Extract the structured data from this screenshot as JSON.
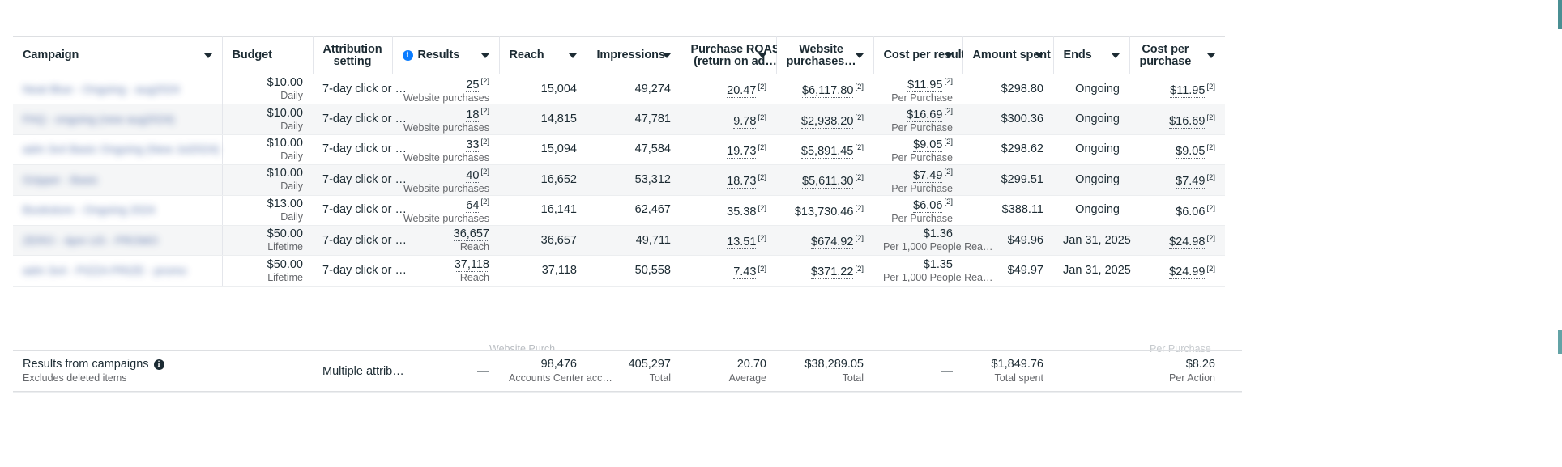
{
  "table": {
    "columns": [
      {
        "id": "campaign",
        "label": "Campaign",
        "sortable": true,
        "info": false,
        "align": "left"
      },
      {
        "id": "budget",
        "label": "Budget",
        "sortable": false,
        "info": false,
        "align": "right"
      },
      {
        "id": "attribution_setting",
        "label": "Attribution",
        "label2": "setting",
        "sortable": false,
        "info": false,
        "align": "left"
      },
      {
        "id": "results",
        "label": "Results",
        "sortable": true,
        "info": true,
        "align": "right"
      },
      {
        "id": "reach",
        "label": "Reach",
        "sortable": true,
        "info": false,
        "align": "right"
      },
      {
        "id": "impressions",
        "label": "Impressions",
        "sortable": true,
        "info": false,
        "align": "right"
      },
      {
        "id": "purchase_roas",
        "label": "Purchase ROAS",
        "label2": "(return on ad…",
        "sortable": true,
        "info": false,
        "align": "right"
      },
      {
        "id": "website_purchases",
        "label": "Website",
        "label2": "purchases…",
        "sortable": true,
        "info": false,
        "align": "right"
      },
      {
        "id": "cost_per_result",
        "label": "Cost per result",
        "sortable": true,
        "info": false,
        "align": "right"
      },
      {
        "id": "amount_spent",
        "label": "Amount spent",
        "sortable": true,
        "info": false,
        "align": "right"
      },
      {
        "id": "ends",
        "label": "Ends",
        "sortable": true,
        "info": false,
        "align": "right"
      },
      {
        "id": "cost_per_purchase",
        "label": "Cost per",
        "label2": "purchase",
        "sortable": true,
        "info": false,
        "align": "right"
      }
    ],
    "rows": [
      {
        "campaign": "Neat Blue - Ongoing - aug2024",
        "budget": "$10.00",
        "budget_sub": "Daily",
        "attribution": "7-day click or …",
        "results": "25",
        "results_sup": "[2]",
        "results_sub": "Website purchases",
        "reach": "15,004",
        "impressions": "49,274",
        "roas": "20.47",
        "roas_sup": "[2]",
        "website_purchases": "$6,117.80",
        "website_purchases_sup": "[2]",
        "cost_per_result": "$11.95",
        "cost_per_result_sup": "[2]",
        "cost_per_result_sub": "Per Purchase",
        "amount_spent": "$298.80",
        "ends": "Ongoing",
        "cost_per_purchase": "$11.95",
        "cost_per_purchase_sup": "[2]"
      },
      {
        "campaign": "FAQ - ongoing (new aug2024)",
        "budget": "$10.00",
        "budget_sub": "Daily",
        "attribution": "7-day click or …",
        "results": "18",
        "results_sup": "[2]",
        "results_sub": "Website purchases",
        "reach": "14,815",
        "impressions": "47,781",
        "roas": "9.78",
        "roas_sup": "[2]",
        "website_purchases": "$2,938.20",
        "website_purchases_sup": "[2]",
        "cost_per_result": "$16.69",
        "cost_per_result_sup": "[2]",
        "cost_per_result_sub": "Per Purchase",
        "amount_spent": "$300.36",
        "ends": "Ongoing",
        "cost_per_purchase": "$16.69",
        "cost_per_purchase_sup": "[2]"
      },
      {
        "campaign": "adm 3x4 Basic Ongoing (New Jul2024)",
        "budget": "$10.00",
        "budget_sub": "Daily",
        "attribution": "7-day click or …",
        "results": "33",
        "results_sup": "[2]",
        "results_sub": "Website purchases",
        "reach": "15,094",
        "impressions": "47,584",
        "roas": "19.73",
        "roas_sup": "[2]",
        "website_purchases": "$5,891.45",
        "website_purchases_sup": "[2]",
        "cost_per_result": "$9.05",
        "cost_per_result_sup": "[2]",
        "cost_per_result_sub": "Per Purchase",
        "amount_spent": "$298.62",
        "ends": "Ongoing",
        "cost_per_purchase": "$9.05",
        "cost_per_purchase_sup": "[2]"
      },
      {
        "campaign": "Gripper - Basic",
        "budget": "$10.00",
        "budget_sub": "Daily",
        "attribution": "7-day click or …",
        "results": "40",
        "results_sup": "[2]",
        "results_sub": "Website purchases",
        "reach": "16,652",
        "impressions": "53,312",
        "roas": "18.73",
        "roas_sup": "[2]",
        "website_purchases": "$5,611.30",
        "website_purchases_sup": "[2]",
        "cost_per_result": "$7.49",
        "cost_per_result_sup": "[2]",
        "cost_per_result_sub": "Per Purchase",
        "amount_spent": "$299.51",
        "ends": "Ongoing",
        "cost_per_purchase": "$7.49",
        "cost_per_purchase_sup": "[2]"
      },
      {
        "campaign": "Bookstore - Ongoing 2024",
        "budget": "$13.00",
        "budget_sub": "Daily",
        "attribution": "7-day click or …",
        "results": "64",
        "results_sup": "[2]",
        "results_sub": "Website purchases",
        "reach": "16,141",
        "impressions": "62,467",
        "roas": "35.38",
        "roas_sup": "[2]",
        "website_purchases": "$13,730.46",
        "website_purchases_sup": "[2]",
        "cost_per_result": "$6.06",
        "cost_per_result_sup": "[2]",
        "cost_per_result_sub": "Per Purchase",
        "amount_spent": "$388.11",
        "ends": "Ongoing",
        "cost_per_purchase": "$6.06",
        "cost_per_purchase_sup": "[2]"
      },
      {
        "campaign": "ZERO - 4pm US - PROMO",
        "budget": "$50.00",
        "budget_sub": "Lifetime",
        "attribution": "7-day click or …",
        "results": "36,657",
        "results_sup": "",
        "results_sub": "Reach",
        "reach": "36,657",
        "impressions": "49,711",
        "roas": "13.51",
        "roas_sup": "[2]",
        "website_purchases": "$674.92",
        "website_purchases_sup": "[2]",
        "cost_per_result": "$1.36",
        "cost_per_result_sup": "",
        "cost_per_result_sub": "Per 1,000 People Rea…",
        "amount_spent": "$49.96",
        "ends": "Jan 31, 2025",
        "cost_per_purchase": "$24.98",
        "cost_per_purchase_sup": "[2]"
      },
      {
        "campaign": "adm 3x4 - PIZZA PRIZE - promo",
        "budget": "$50.00",
        "budget_sub": "Lifetime",
        "attribution": "7-day click or …",
        "results": "37,118",
        "results_sup": "",
        "results_sub": "Reach",
        "reach": "37,118",
        "impressions": "50,558",
        "roas": "7.43",
        "roas_sup": "[2]",
        "website_purchases": "$371.22",
        "website_purchases_sup": "[2]",
        "cost_per_result": "$1.35",
        "cost_per_result_sup": "",
        "cost_per_result_sub": "Per 1,000 People Rea…",
        "amount_spent": "$49.97",
        "ends": "Jan 31, 2025",
        "cost_per_purchase": "$24.99",
        "cost_per_purchase_sup": "[2]"
      }
    ],
    "partial_row_text": "Website Purch…",
    "partial_row_text_right": "Per Purchase"
  },
  "summary": {
    "title": "Results from campaigns",
    "subtitle": "Excludes deleted items",
    "attribution": "Multiple attrib…",
    "results": "—",
    "reach": "98,476",
    "reach_sub": "Accounts Center acc…",
    "impressions": "405,297",
    "impressions_sub": "Total",
    "roas": "20.70",
    "roas_sub": "Average",
    "website_purchases": "$38,289.05",
    "website_purchases_sub": "Total",
    "cost_per_result": "—",
    "amount_spent": "$1,849.76",
    "amount_spent_sub": "Total spent",
    "ends": "",
    "cost_per_purchase": "$8.26",
    "cost_per_purchase_sub": "Per Action"
  },
  "icons": {
    "info": "i",
    "caret": "caret-down-icon"
  },
  "colors": {
    "link": "#3b5a9a",
    "info_blue": "#0a7cff",
    "text": "#1c2b33",
    "muted": "#65676b",
    "row_alt": "#f5f6f7",
    "border": "#dddfe2",
    "accent_teal": "#4a8f93"
  }
}
